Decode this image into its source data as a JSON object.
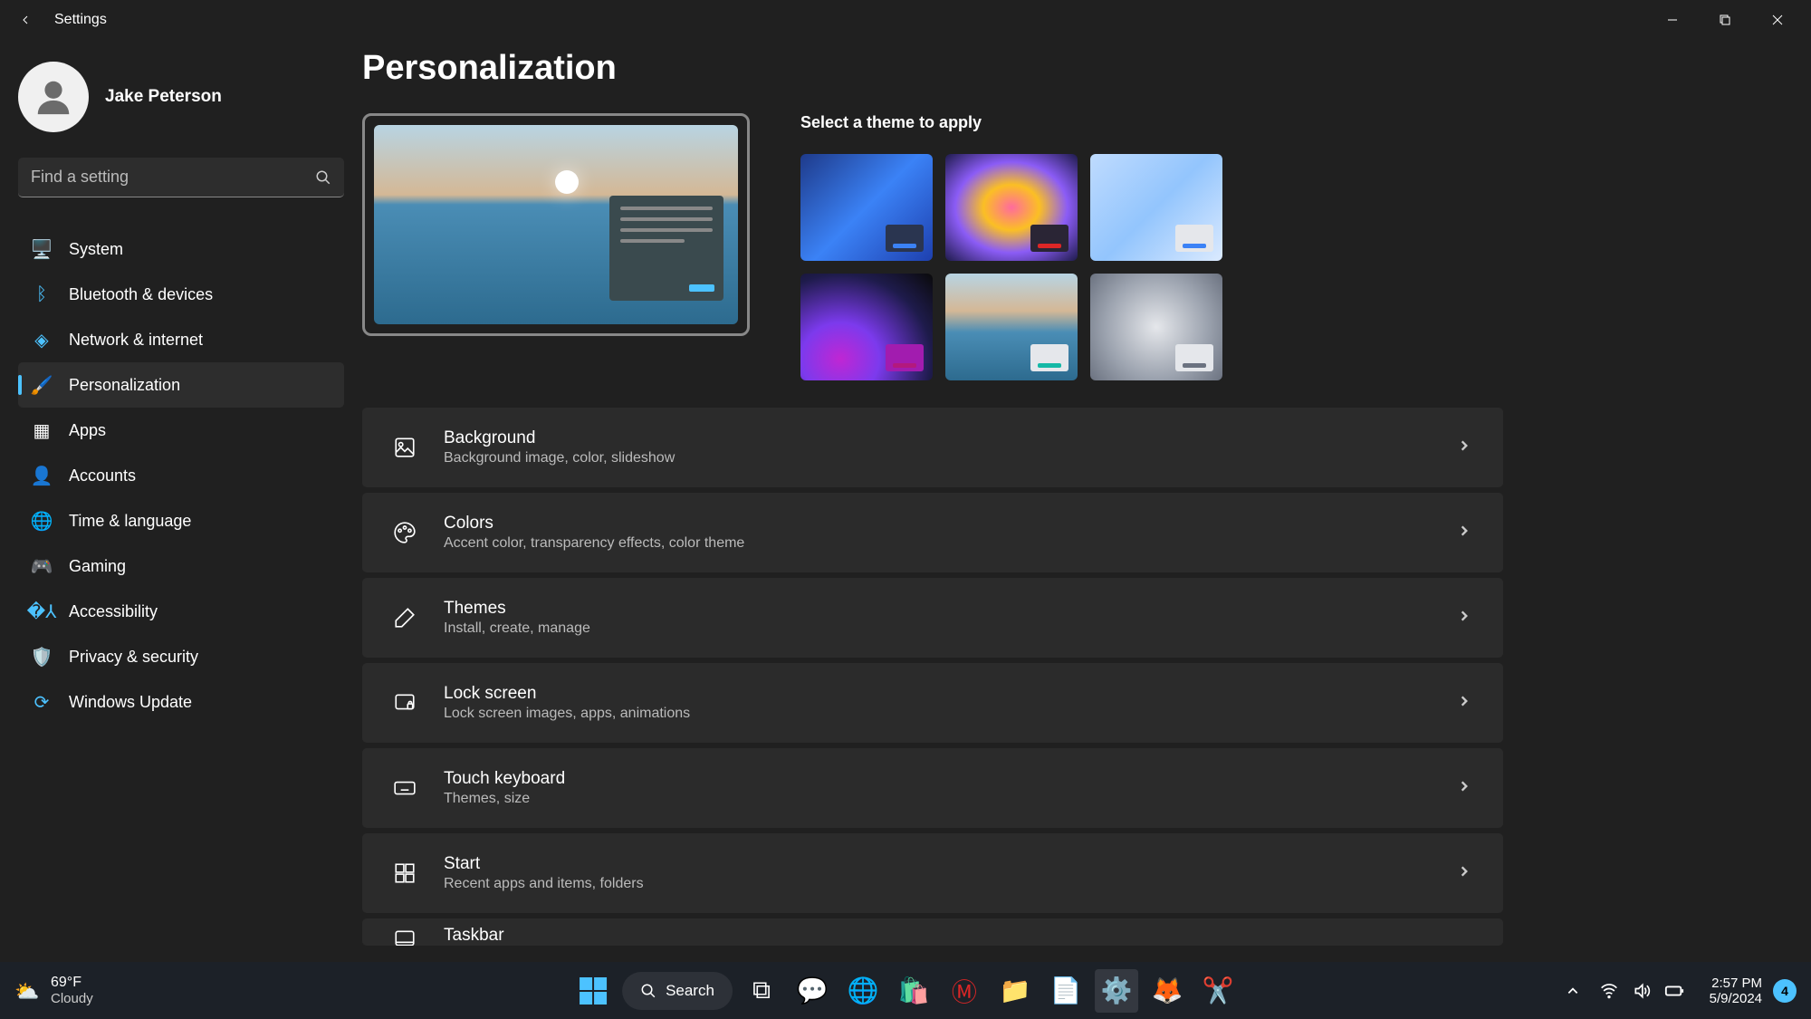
{
  "titlebar": {
    "title": "Settings"
  },
  "user": {
    "name": "Jake Peterson"
  },
  "search": {
    "placeholder": "Find a setting"
  },
  "nav": {
    "items": [
      {
        "label": "System"
      },
      {
        "label": "Bluetooth & devices"
      },
      {
        "label": "Network & internet"
      },
      {
        "label": "Personalization"
      },
      {
        "label": "Apps"
      },
      {
        "label": "Accounts"
      },
      {
        "label": "Time & language"
      },
      {
        "label": "Gaming"
      },
      {
        "label": "Accessibility"
      },
      {
        "label": "Privacy & security"
      },
      {
        "label": "Windows Update"
      }
    ]
  },
  "page": {
    "title": "Personalization",
    "theme_heading": "Select a theme to apply"
  },
  "settings": [
    {
      "title": "Background",
      "desc": "Background image, color, slideshow"
    },
    {
      "title": "Colors",
      "desc": "Accent color, transparency effects, color theme"
    },
    {
      "title": "Themes",
      "desc": "Install, create, manage"
    },
    {
      "title": "Lock screen",
      "desc": "Lock screen images, apps, animations"
    },
    {
      "title": "Touch keyboard",
      "desc": "Themes, size"
    },
    {
      "title": "Start",
      "desc": "Recent apps and items, folders"
    },
    {
      "title": "Taskbar",
      "desc": ""
    }
  ],
  "taskbar": {
    "weather_temp": "69°F",
    "weather_cond": "Cloudy",
    "search_label": "Search",
    "time": "2:57 PM",
    "date": "5/9/2024",
    "notif_count": "4"
  }
}
